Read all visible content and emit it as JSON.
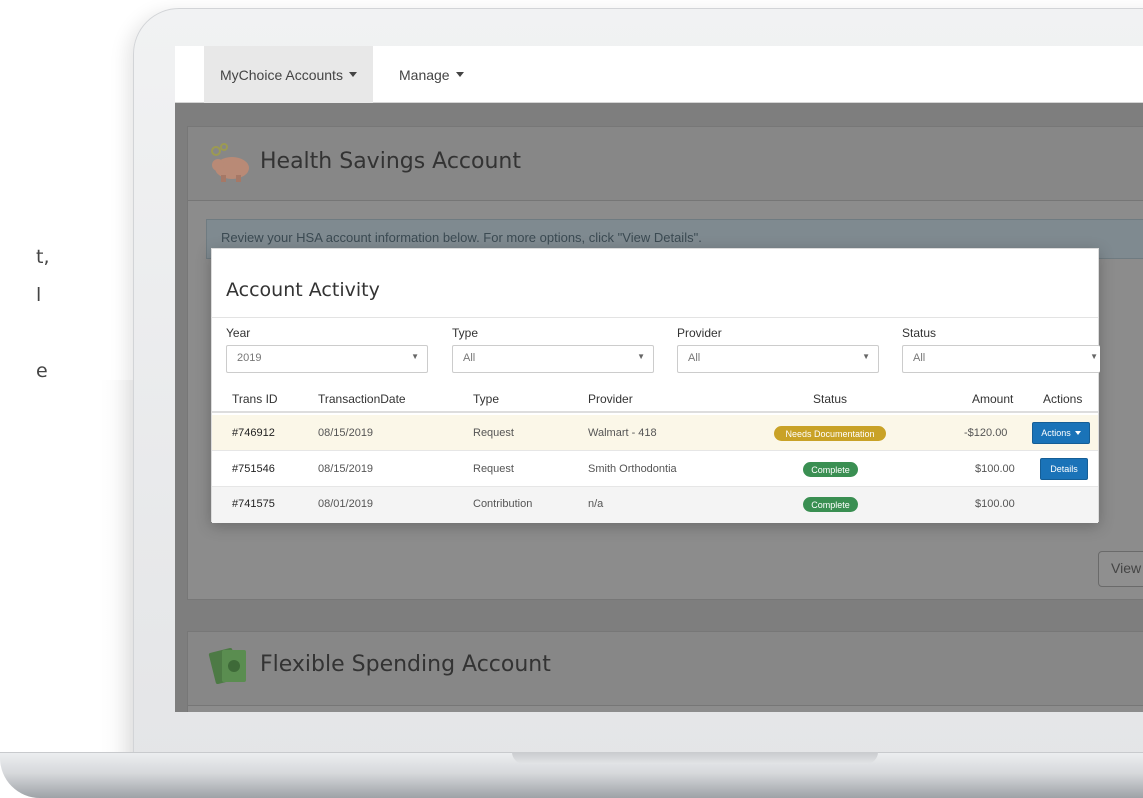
{
  "left_text": {
    "line1": "t,",
    "line2": "l",
    "line3": "e"
  },
  "nav": {
    "item1": "MyChoice Accounts",
    "item2": "Manage"
  },
  "hsa": {
    "title": "Health Savings Account",
    "info": "Review your HSA account information below. For more options, click \"View Details\".",
    "view_button": "View"
  },
  "fsa": {
    "title": "Flexible Spending Account"
  },
  "activity": {
    "title": "Account Activity",
    "filters": [
      {
        "label": "Year",
        "value": "2019"
      },
      {
        "label": "Type",
        "value": "All"
      },
      {
        "label": "Provider",
        "value": "All"
      },
      {
        "label": "Status",
        "value": "All"
      }
    ],
    "columns": [
      "Trans ID",
      "TransactionDate",
      "Type",
      "Provider",
      "Status",
      "Amount",
      "Actions"
    ],
    "rows": [
      {
        "id": "#746912",
        "date": "08/15/2019",
        "type": "Request",
        "provider": "Walmart - 418",
        "status": "Needs Documentation",
        "amount": "-$120.00",
        "action": "Actions"
      },
      {
        "id": "#751546",
        "date": "08/15/2019",
        "type": "Request",
        "provider": "Smith Orthodontia",
        "status": "Complete",
        "amount": "$100.00",
        "action": "Details"
      },
      {
        "id": "#741575",
        "date": "08/01/2019",
        "type": "Contribution",
        "provider": "n/a",
        "status": "Complete",
        "amount": "$100.00",
        "action": ""
      }
    ]
  },
  "colors": {
    "warning_badge": "#c9a227",
    "success_badge": "#3a8f52",
    "primary_button": "#1a73b8",
    "highlight_row": "#fbf7e8"
  }
}
